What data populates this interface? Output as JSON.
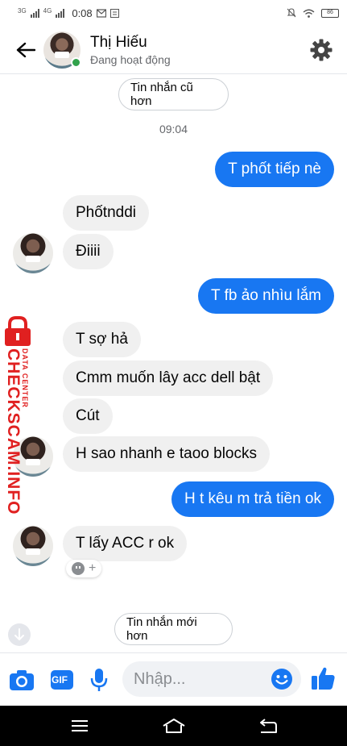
{
  "status_bar": {
    "net1": "3G",
    "net2": "4G",
    "time": "0:08",
    "battery": "86"
  },
  "header": {
    "contact_name": "Thị Hiếu ",
    "contact_status": "Đang hoạt động",
    "accent_color": "#1877f2",
    "online_color": "#31a24c"
  },
  "chat": {
    "older_messages_label": "Tin nhắn cũ hơn",
    "timestamp": "09:04",
    "messages": [
      {
        "direction": "out",
        "text": "T phốt tiếp nè"
      },
      {
        "direction": "in",
        "text": "Phốtnddi"
      },
      {
        "direction": "in",
        "text": "Điiii"
      },
      {
        "direction": "out",
        "text": "T fb ảo nhìu lắm"
      },
      {
        "direction": "in",
        "text": "T sợ hả"
      },
      {
        "direction": "in",
        "text": "Cmm muốn lây acc dell bật"
      },
      {
        "direction": "in",
        "text": "Cút"
      },
      {
        "direction": "in",
        "text": "H sao nhanh e taoo blocks"
      },
      {
        "direction": "out",
        "text": "H t kêu m trả tiền ok"
      },
      {
        "direction": "in",
        "text": "T lấy ACC r ok"
      }
    ],
    "newer_messages_label": "Tin nhắn mới hơn"
  },
  "watermark": {
    "main": "CHECKSCAM.INFO",
    "sub": "DATA CENTER"
  },
  "composer": {
    "placeholder": "Nhập...",
    "gif_label": "GIF"
  },
  "icons": [
    "back-arrow-icon",
    "gear-icon",
    "camera-icon",
    "gif-icon",
    "microphone-icon",
    "emoji-icon",
    "thumbs-up-icon",
    "scroll-down-icon",
    "menu-icon",
    "home-icon",
    "return-icon"
  ]
}
